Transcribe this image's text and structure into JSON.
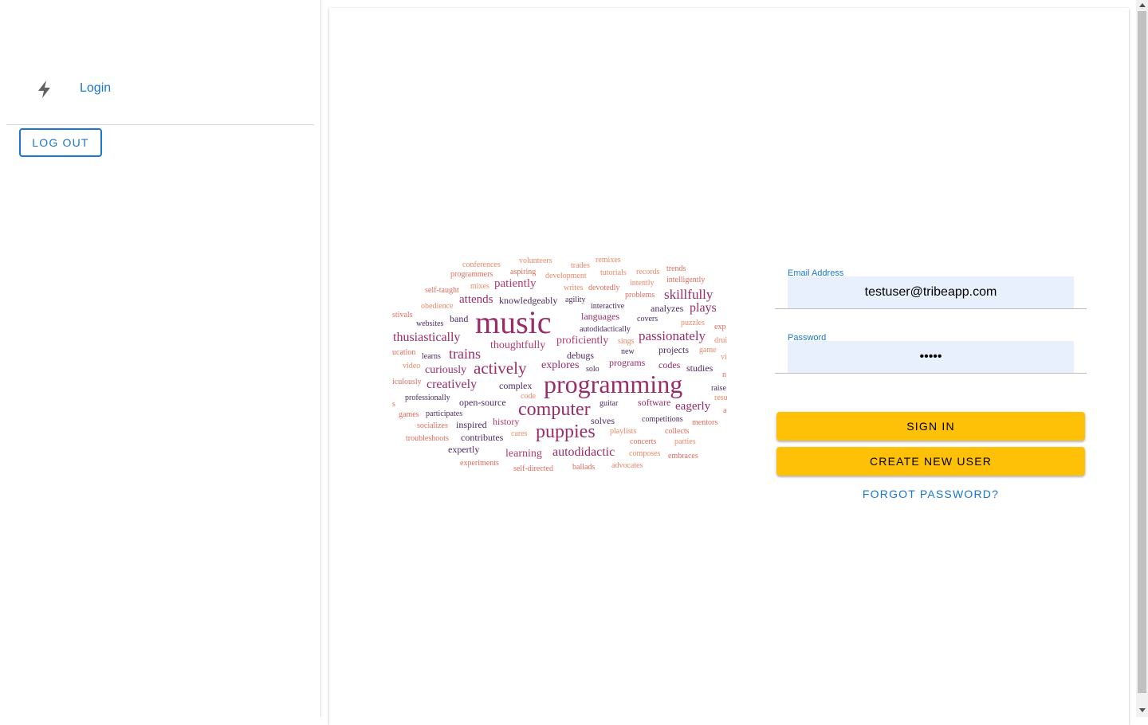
{
  "sidebar": {
    "nav_items": [
      {
        "label": "Login",
        "icon": "bolt-icon"
      }
    ],
    "logout_label": "LOG OUT"
  },
  "form": {
    "email_label": "Email Address",
    "email_value": "testuser@tribeapp.com",
    "password_label": "Password",
    "password_value": "•••••",
    "sign_in_label": "SIGN IN",
    "create_user_label": "CREATE NEW USER",
    "forgot_label": "FORGOT PASSWORD?"
  },
  "wordcloud": {
    "words": [
      {
        "text": "conferences",
        "color": "#ee8866"
      },
      {
        "text": "volunteers",
        "color": "#ee8866"
      },
      {
        "text": "remixes",
        "color": "#ee8866"
      },
      {
        "text": "trades",
        "color": "#ee8866"
      },
      {
        "text": "programmers",
        "color": "#e06b5c"
      },
      {
        "text": "aspiring",
        "color": "#e06b5c"
      },
      {
        "text": "development",
        "color": "#ee8866"
      },
      {
        "text": "tutorials",
        "color": "#ee8866"
      },
      {
        "text": "records",
        "color": "#ee8866"
      },
      {
        "text": "trends",
        "color": "#e06b5c"
      },
      {
        "text": "intelligently",
        "color": "#e06b5c"
      },
      {
        "text": "self-taught",
        "color": "#e06b5c"
      },
      {
        "text": "mixes",
        "color": "#ee8866"
      },
      {
        "text": "patiently",
        "color": "#b23a6a"
      },
      {
        "text": "writes",
        "color": "#ee8866"
      },
      {
        "text": "devotedly",
        "color": "#e06b5c"
      },
      {
        "text": "intently",
        "color": "#ee8866"
      },
      {
        "text": "skillfully",
        "color": "#9a2c68"
      },
      {
        "text": "problems",
        "color": "#e06b5c"
      },
      {
        "text": "attends",
        "color": "#9a2c68"
      },
      {
        "text": "knowledgeably",
        "color": "#4b2a5f"
      },
      {
        "text": "agility",
        "color": "#4b2a5f"
      },
      {
        "text": "obedience",
        "color": "#ee8866"
      },
      {
        "text": "interactive",
        "color": "#4b2a5f"
      },
      {
        "text": "analyzes",
        "color": "#4b2a5f"
      },
      {
        "text": "plays",
        "color": "#9a2c68"
      },
      {
        "text": "stivals",
        "color": "#e06b5c"
      },
      {
        "text": "band",
        "color": "#4b2a5f"
      },
      {
        "text": "music",
        "color": "#9a2c68"
      },
      {
        "text": "languages",
        "color": "#9a2c68"
      },
      {
        "text": "covers",
        "color": "#4b2a5f"
      },
      {
        "text": "puzzles",
        "color": "#ee8866"
      },
      {
        "text": "exp",
        "color": "#e06b5c"
      },
      {
        "text": "websites",
        "color": "#4b2a5f"
      },
      {
        "text": "autodidactically",
        "color": "#4b2a5f"
      },
      {
        "text": "thusiastically",
        "color": "#9a2c68"
      },
      {
        "text": "passionately",
        "color": "#9a2c68"
      },
      {
        "text": "proficiently",
        "color": "#b23a6a"
      },
      {
        "text": "drui",
        "color": "#ee8866"
      },
      {
        "text": "thoughtfully",
        "color": "#b23a6a"
      },
      {
        "text": "sings",
        "color": "#ee8866"
      },
      {
        "text": "projects",
        "color": "#4b2a5f"
      },
      {
        "text": "game",
        "color": "#ee8866"
      },
      {
        "text": "ucation",
        "color": "#e06b5c"
      },
      {
        "text": "learns",
        "color": "#4b2a5f"
      },
      {
        "text": "trains",
        "color": "#9a2c68"
      },
      {
        "text": "debugs",
        "color": "#4b2a5f"
      },
      {
        "text": "new",
        "color": "#4b2a5f"
      },
      {
        "text": "vi",
        "color": "#ee8866"
      },
      {
        "text": "video",
        "color": "#ee8866"
      },
      {
        "text": "curiously",
        "color": "#9a2c68"
      },
      {
        "text": "actively",
        "color": "#9a2c68"
      },
      {
        "text": "explores",
        "color": "#9a2c68"
      },
      {
        "text": "solo",
        "color": "#4b2a5f"
      },
      {
        "text": "programs",
        "color": "#9a2c68"
      },
      {
        "text": "codes",
        "color": "#9a2c68"
      },
      {
        "text": "studies",
        "color": "#4b2a5f"
      },
      {
        "text": "n",
        "color": "#e06b5c"
      },
      {
        "text": "iculously",
        "color": "#e06b5c"
      },
      {
        "text": "creatively",
        "color": "#9a2c68"
      },
      {
        "text": "complex",
        "color": "#4b2a5f"
      },
      {
        "text": "programming",
        "color": "#9a2c68"
      },
      {
        "text": "raise",
        "color": "#4b2a5f"
      },
      {
        "text": "professionally",
        "color": "#4b2a5f"
      },
      {
        "text": "code",
        "color": "#ee8866"
      },
      {
        "text": "resu",
        "color": "#ee8866"
      },
      {
        "text": "s",
        "color": "#e06b5c"
      },
      {
        "text": "open-source",
        "color": "#4b2a5f"
      },
      {
        "text": "guitar",
        "color": "#4b2a5f"
      },
      {
        "text": "software",
        "color": "#9a2c68"
      },
      {
        "text": "eagerly",
        "color": "#9a2c68"
      },
      {
        "text": "a",
        "color": "#e06b5c"
      },
      {
        "text": "games",
        "color": "#e06b5c"
      },
      {
        "text": "participates",
        "color": "#4b2a5f"
      },
      {
        "text": "computer",
        "color": "#9a2c68"
      },
      {
        "text": "socializes",
        "color": "#e06b5c"
      },
      {
        "text": "inspired",
        "color": "#4b2a5f"
      },
      {
        "text": "history",
        "color": "#b23a6a"
      },
      {
        "text": "solves",
        "color": "#4b2a5f"
      },
      {
        "text": "competitions",
        "color": "#4b2a5f"
      },
      {
        "text": "mentors",
        "color": "#e06b5c"
      },
      {
        "text": "cares",
        "color": "#ee8866"
      },
      {
        "text": "playlists",
        "color": "#ee8866"
      },
      {
        "text": "collects",
        "color": "#e06b5c"
      },
      {
        "text": "troubleshoots",
        "color": "#e06b5c"
      },
      {
        "text": "contributes",
        "color": "#4b2a5f"
      },
      {
        "text": "puppies",
        "color": "#9a2c68"
      },
      {
        "text": "concerts",
        "color": "#e06b5c"
      },
      {
        "text": "parties",
        "color": "#ee8866"
      },
      {
        "text": "expertly",
        "color": "#4b2a5f"
      },
      {
        "text": "learning",
        "color": "#b23a6a"
      },
      {
        "text": "autodidactic",
        "color": "#9a2c68"
      },
      {
        "text": "composes",
        "color": "#ee8866"
      },
      {
        "text": "embraces",
        "color": "#e06b5c"
      },
      {
        "text": "experiments",
        "color": "#e06b5c"
      },
      {
        "text": "self-directed",
        "color": "#e06b5c"
      },
      {
        "text": "ballads",
        "color": "#e06b5c"
      },
      {
        "text": "advocates",
        "color": "#ee8866"
      }
    ]
  }
}
